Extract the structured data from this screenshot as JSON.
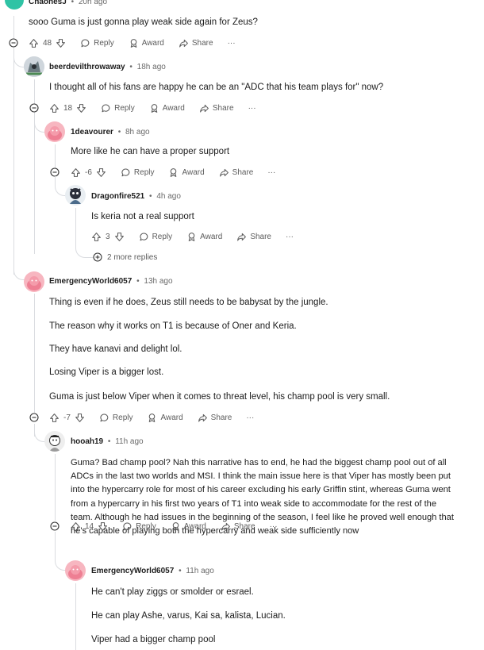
{
  "thread": {
    "top": {
      "author": "ChaonesJ",
      "age": "20h ago",
      "text": "sooo Guma is just gonna play weak side again for Zeus?",
      "score": "48"
    },
    "c1": {
      "author": "beerdevilthrowaway",
      "age": "18h ago",
      "text": "I thought all of his fans are happy he can be an \"ADC that his team plays for\" now?",
      "score": "18"
    },
    "c1a": {
      "author": "1deavourer",
      "age": "8h ago",
      "text": "More like he can have a proper support",
      "score": "-6"
    },
    "c1b": {
      "author": "Dragonfire521",
      "age": "4h ago",
      "text": "Is keria not a real support",
      "score": "3",
      "more_replies": "2 more replies"
    },
    "c2": {
      "author": "EmergencyWorld6057",
      "age": "13h ago",
      "paragraphs": [
        "Thing is even if he does, Zeus still needs to be babysat by the jungle.",
        "The reason why it works on T1 is because of Oner and Keria.",
        "They have kanavi and delight lol.",
        "Losing Viper is a bigger lost.",
        "Guma is just below Viper when it comes to threat level, his champ pool is very small."
      ],
      "score": "-7"
    },
    "c2a": {
      "author": "hooah19",
      "age": "11h ago",
      "lines": [
        "Guma? Bad champ pool? Nah this narrative has to end, he had the biggest champ pool out of all",
        "ADCs in the last two worlds and MSI. I think the main issue here is that Viper has mostly been put",
        "into the hypercarry role for most of his career excluding his early Griffin stint, whereas Guma went",
        "from a hypercarry in his first two years of T1 into weak side to accommodate for the rest of the",
        "team. Although he had issues in the beginning of the season, I feel like he proved well enough that",
        "he's capable of playing both the hypercarry and weak side sufficiently now"
      ],
      "score": "14"
    },
    "c2b": {
      "author": "EmergencyWorld6057",
      "age": "11h ago",
      "paragraphs": [
        "He can't play ziggs or smolder or esrael.",
        "He can play Ashe, varus, Kai sa, kalista, Lucian.",
        "Viper had a bigger champ pool"
      ]
    }
  },
  "actions": {
    "reply": "Reply",
    "award": "Award",
    "share": "Share",
    "overflow": "···",
    "dot": "•"
  },
  "colors": {
    "line": "#dadce0",
    "text": "#1c1c1c",
    "muted": "#5c5c5c",
    "pink_avatar": "#f28b9a",
    "teal_avatar": "#24c7a8"
  }
}
